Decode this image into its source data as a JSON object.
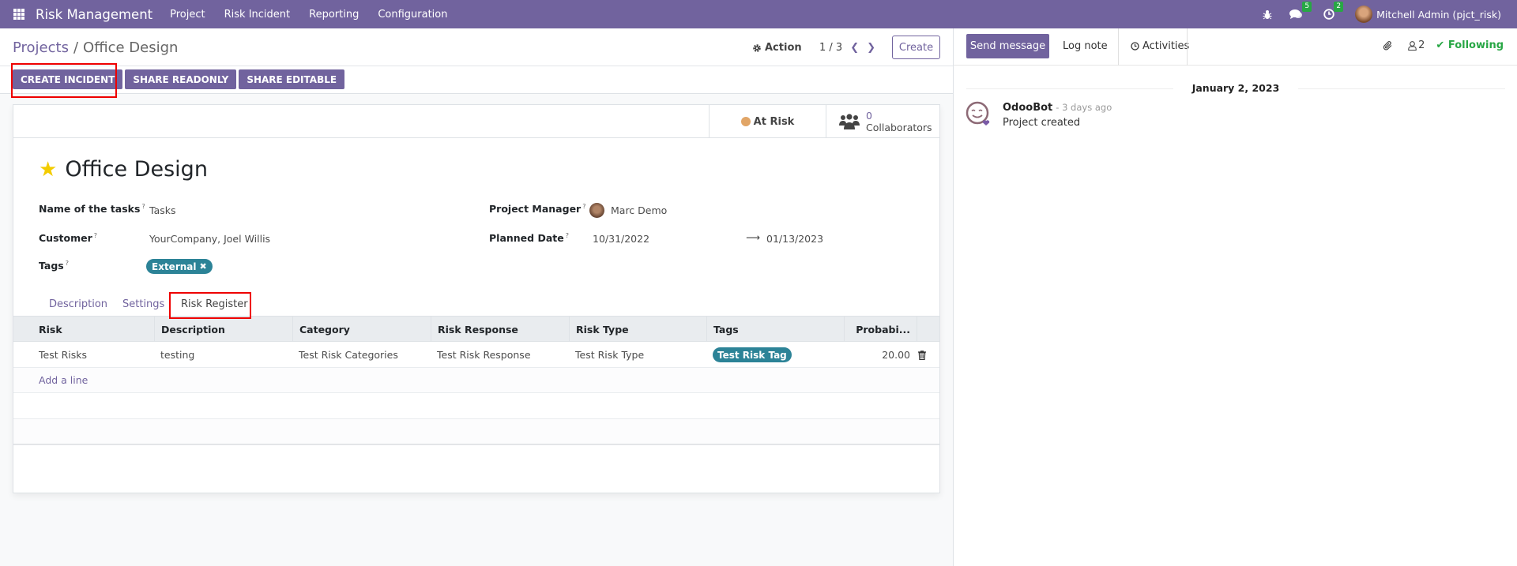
{
  "navbar": {
    "brand": "Risk Management",
    "menu": [
      "Project",
      "Risk Incident",
      "Reporting",
      "Configuration"
    ],
    "messages_badge": "5",
    "activities_badge": "2",
    "user": "Mitchell Admin (pjct_risk)"
  },
  "control_panel": {
    "breadcrumb_parent": "Projects",
    "breadcrumb_current": "Office Design",
    "action_label": "Action",
    "pager": "1 / 3",
    "create_label": "Create",
    "header_buttons": [
      "CREATE INCIDENT",
      "SHARE READONLY",
      "SHARE EDITABLE"
    ]
  },
  "form": {
    "status_label": "At Risk",
    "status_color": "#e1a567",
    "collaborators_count": "0",
    "collaborators_label": "Collaborators",
    "title": "Office Design",
    "fields": {
      "tasks_label": "Name of the tasks",
      "tasks_value": "Tasks",
      "customer_label": "Customer",
      "customer_value": "YourCompany, Joel Willis",
      "tags_label": "Tags",
      "tags_value": "External",
      "manager_label": "Project Manager",
      "manager_value": "Marc Demo",
      "planned_label": "Planned Date",
      "planned_start": "10/31/2022",
      "planned_end": "01/13/2023"
    },
    "tabs": [
      "Description",
      "Settings",
      "Risk Register"
    ],
    "active_tab": "Risk Register",
    "table": {
      "columns": [
        "Risk",
        "Description",
        "Category",
        "Risk Response",
        "Risk Type",
        "Tags",
        "Probabi..."
      ],
      "rows": [
        {
          "risk": "Test Risks",
          "description": "testing",
          "category": "Test Risk Categories",
          "response": "Test Risk Response",
          "type": "Test Risk Type",
          "tag": "Test Risk Tag",
          "probability": "20.00"
        }
      ],
      "add_line_label": "Add a line"
    }
  },
  "chatter": {
    "send_message": "Send message",
    "log_note": "Log note",
    "activities": "Activities",
    "followers_count": "2",
    "following_label": "Following",
    "date_separator": "January 2, 2023",
    "messages": [
      {
        "author": "OdooBot",
        "time": "- 3 days ago",
        "body": "Project created"
      }
    ]
  },
  "colors": {
    "brand": "#71639e",
    "tag": "#2c8397",
    "following": "#28a745",
    "highlight": "#ee0000"
  }
}
